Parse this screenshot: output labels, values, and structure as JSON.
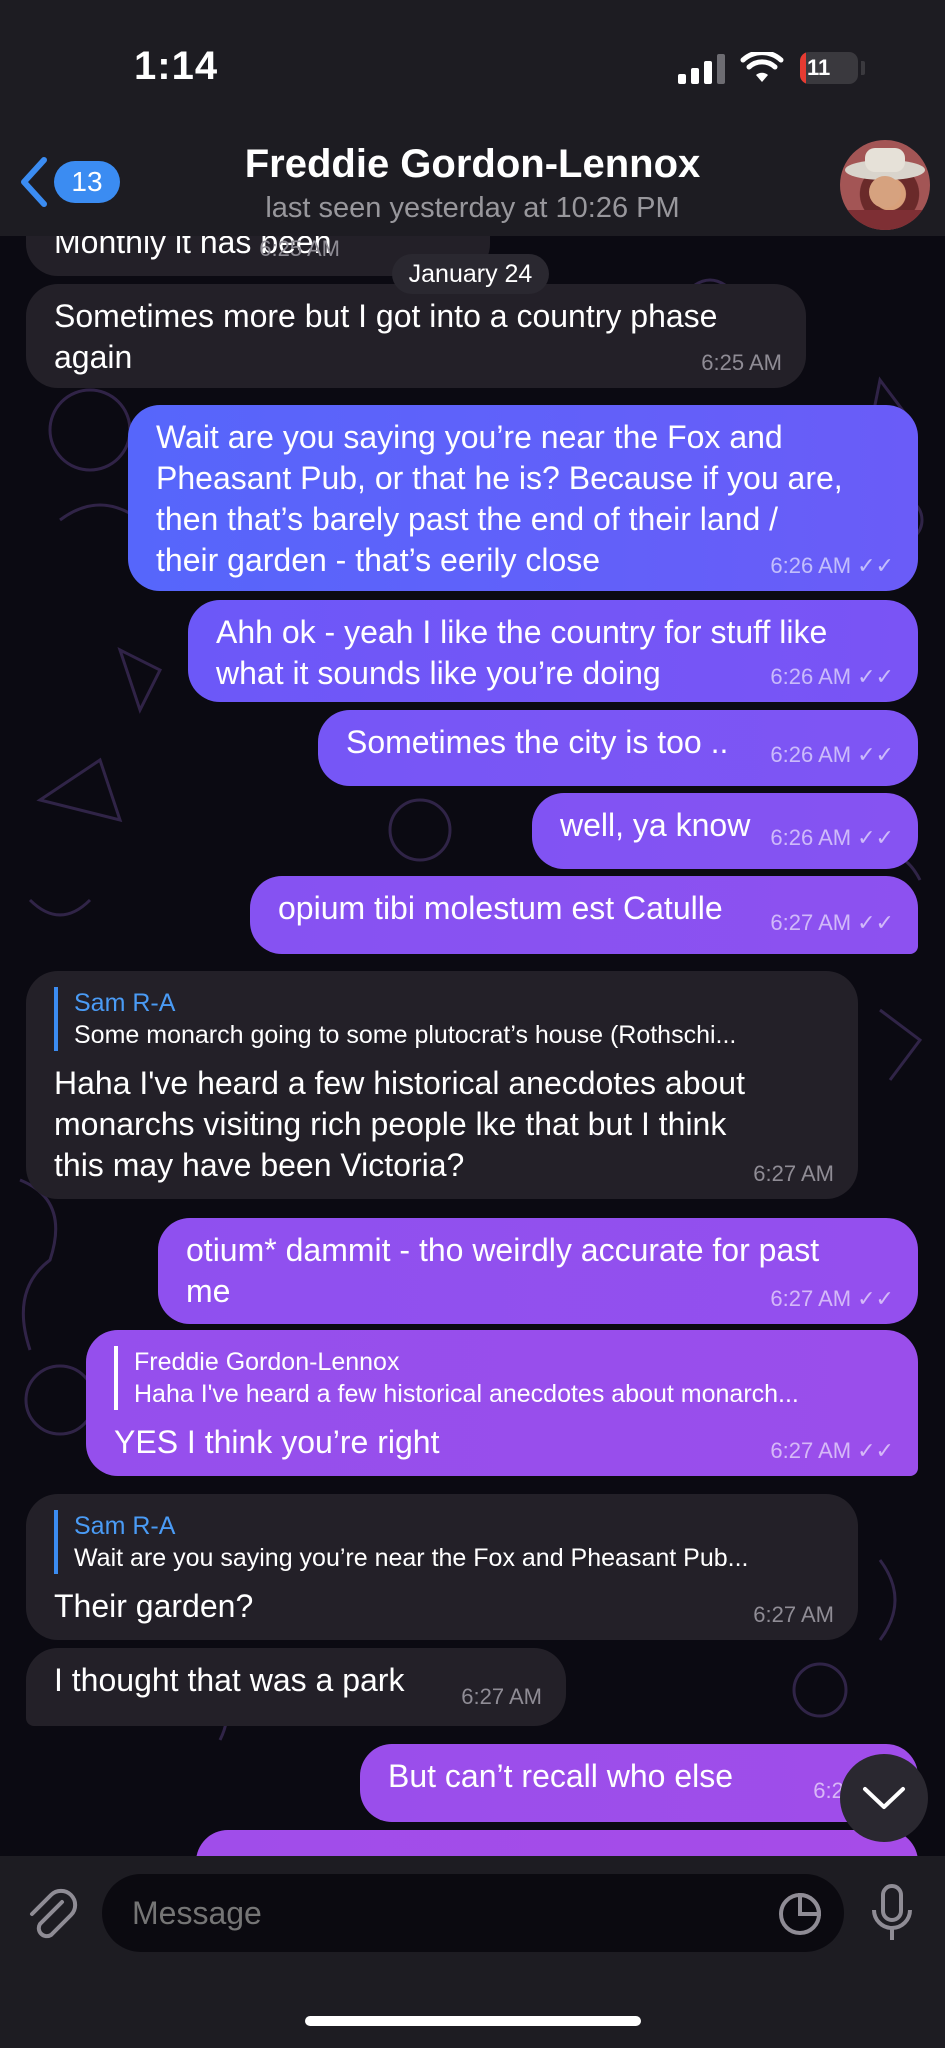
{
  "status": {
    "time": "1:14",
    "battery": "11"
  },
  "header": {
    "back_count": "13",
    "name": "Freddie Gordon-Lennox",
    "last_seen": "last seen yesterday at 10:26 PM"
  },
  "date_label": "January 24",
  "messages": [
    {
      "text": "Monthly it has been",
      "time": "6:25 AM"
    },
    {
      "text": "Sometimes more but I got into a country phase\nagain",
      "time": "6:25 AM"
    },
    {
      "text": "Wait are you saying you’re near the Fox and\nPheasant Pub, or that he is? Because if you are,\nthen that’s barely past the end of their land /\ntheir garden - that’s eerily close",
      "time": "6:26 AM"
    },
    {
      "text": "Ahh ok - yeah I like the country for stuff like\nwhat it sounds like you’re doing",
      "time": "6:26 AM"
    },
    {
      "text": "Sometimes the city is too ..",
      "time": "6:26 AM"
    },
    {
      "text": "well, ya know",
      "time": "6:26 AM"
    },
    {
      "text": "opium tibi molestum est Catulle",
      "time": "6:27 AM"
    },
    {
      "reply_name": "Sam R-A",
      "reply_text": "Some monarch going to some plutocrat’s house (Rothschi...",
      "text": "Haha I've heard a few historical anecdotes about\nmonarchs visiting rich people lke that but I think\nthis may have been Victoria?",
      "time": "6:27 AM"
    },
    {
      "text": "otium* dammit - tho weirdly accurate for past\nme",
      "time": "6:27 AM"
    },
    {
      "reply_name": "Freddie Gordon-Lennox",
      "reply_text": "Haha I've heard a few historical anecdotes about monarch...",
      "text": "YES I think you’re right",
      "time": "6:27 AM"
    },
    {
      "reply_name": "Sam R-A",
      "reply_text": "Wait are you saying you’re near the Fox and Pheasant Pub...",
      "text": "Their garden?",
      "time": "6:27 AM"
    },
    {
      "text": "I thought that was a park",
      "time": "6:27 AM"
    },
    {
      "text": "But can’t recall who else",
      "time": "6:27 AM"
    }
  ],
  "composer": {
    "placeholder": "Message"
  },
  "colors": {
    "accent": "#3b8cf2",
    "outgoing": "#8a4ff0",
    "incoming": "#232028"
  }
}
